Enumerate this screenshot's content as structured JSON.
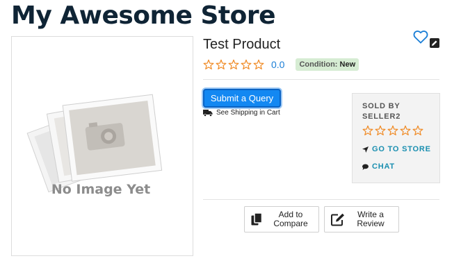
{
  "store": {
    "title": "My Awesome Store"
  },
  "product": {
    "name": "Test Product",
    "image_text": "No Image Yet",
    "rating": {
      "value": "0.0",
      "stars": 0,
      "max": 5
    },
    "condition": {
      "label": "Condition:",
      "value": "New"
    }
  },
  "actions": {
    "submit_query": "Submit a Query",
    "shipping_note": "See Shipping in Cart",
    "add_to_compare_line1": "Add to",
    "add_to_compare_line2": "Compare",
    "write_review_line1": "Write a",
    "write_review_line2": "Review"
  },
  "seller": {
    "sold_by_label": "SOLD BY",
    "name": "SELLER2",
    "stars": 0,
    "go_to_store": "GO TO STORE",
    "chat": "CHAT"
  },
  "icons": {
    "favorite": "heart-outline-icon",
    "edit": "pencil-icon",
    "shipping": "truck-icon",
    "store": "location-arrow-icon",
    "chat": "comment-icon",
    "compare": "copy-icon",
    "review": "edit-square-icon"
  },
  "colors": {
    "accent_blue": "#1388f2",
    "star_orange": "#f08a24",
    "link_teal": "#1a8fb0",
    "badge_green": "#d6ecd3",
    "title_navy": "#0f2435"
  }
}
